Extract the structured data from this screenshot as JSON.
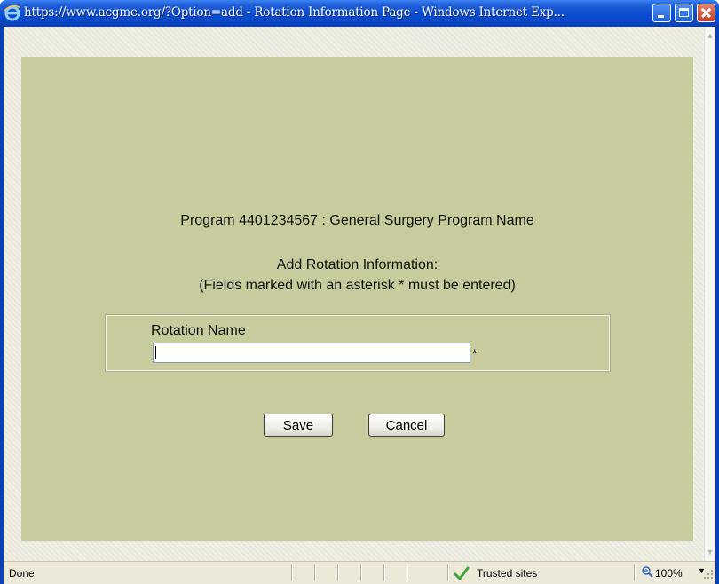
{
  "window": {
    "title": "https://www.acgme.org/?Option=add - Rotation Information Page - Windows Internet Exp...",
    "icon": "ie-icon"
  },
  "page": {
    "program_line": "Program 4401234567 : General Surgery Program Name",
    "add_title": "Add Rotation Information:",
    "add_note": "(Fields marked with an asterisk * must be entered)",
    "rotation_label": "Rotation Name",
    "rotation_value": "",
    "required_marker": "*",
    "save_label": "Save",
    "cancel_label": "Cancel"
  },
  "statusbar": {
    "status": "Done",
    "zone": "Trusted sites",
    "zoom": "100%"
  },
  "colors": {
    "panel": "#c8cc9c",
    "titlebar": "#0a4cd0"
  }
}
